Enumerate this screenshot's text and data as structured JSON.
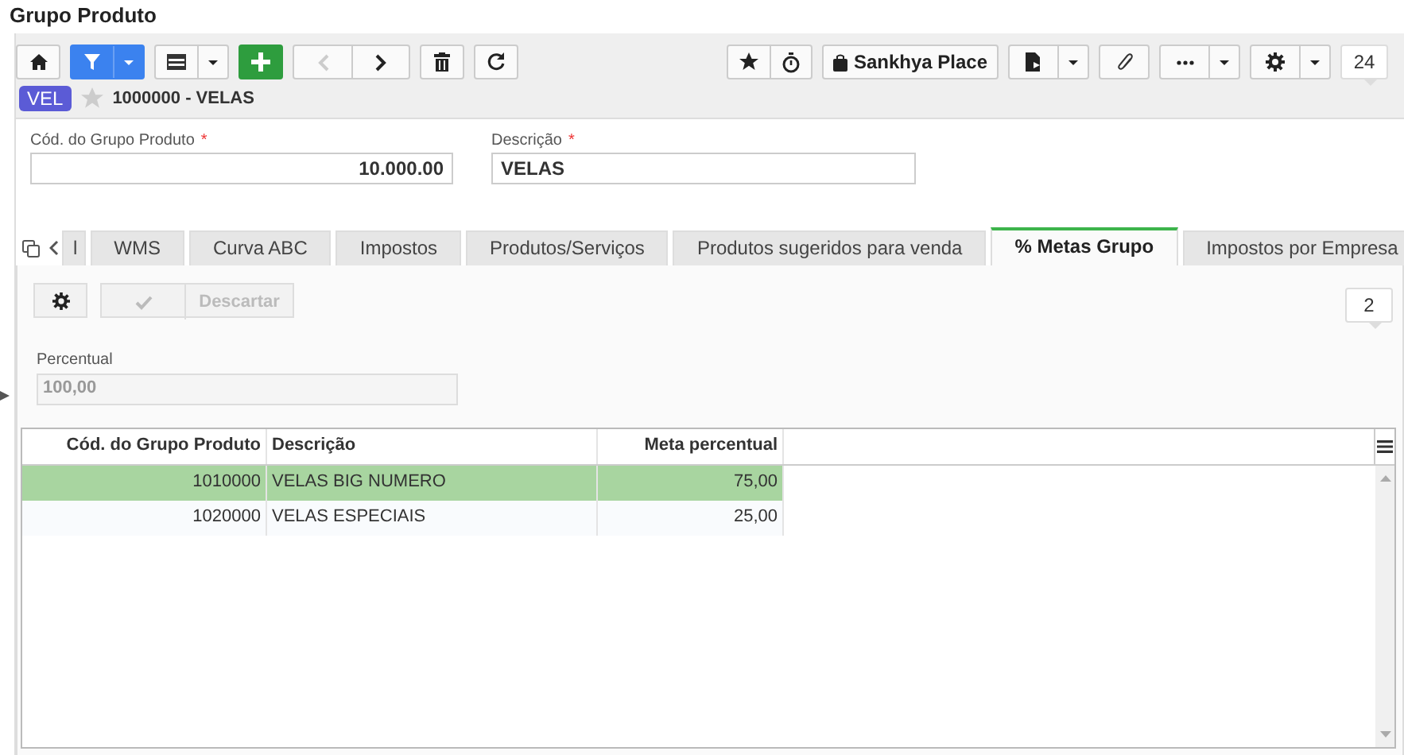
{
  "window": {
    "title": "Grupo Produto"
  },
  "toolbar": {
    "previous_disabled": true,
    "place_label": "Sankhya Place",
    "counter": "24"
  },
  "record": {
    "badge": "VEL",
    "favorite": false,
    "title": "1000000 - VELAS"
  },
  "fields": [
    {
      "label": "Cód. do Grupo Produto",
      "required_mark": "*",
      "value": "10.000.00"
    },
    {
      "label": "Descrição",
      "required_mark": "*",
      "value": "VELAS"
    }
  ],
  "tabs": [
    {
      "label": "l",
      "selected": false
    },
    {
      "label": "WMS",
      "selected": false
    },
    {
      "label": "Curva ABC",
      "selected": false
    },
    {
      "label": "Impostos",
      "selected": false
    },
    {
      "label": "Produtos/Serviços",
      "selected": false
    },
    {
      "label": "Produtos sugeridos para venda",
      "selected": false
    },
    {
      "label": "% Metas Grupo",
      "selected": true
    },
    {
      "label": "Impostos por Empresa",
      "selected": false
    }
  ],
  "subtoolbar": {
    "confirm_disabled": true,
    "discard": {
      "label": "Descartar",
      "disabled": true
    },
    "count": "2"
  },
  "percent_field": {
    "label": "Percentual",
    "value": "100,00",
    "disabled": true
  },
  "table": {
    "columns": [
      "Cód. do Grupo Produto",
      "Descrição",
      "Meta percentual"
    ],
    "rows": [
      {
        "cells": [
          "1010000",
          "VELAS BIG NUMERO",
          "75,00"
        ],
        "selected": true
      },
      {
        "cells": [
          "1020000",
          "VELAS ESPECIAIS",
          "25,00"
        ],
        "selected": false
      }
    ]
  }
}
